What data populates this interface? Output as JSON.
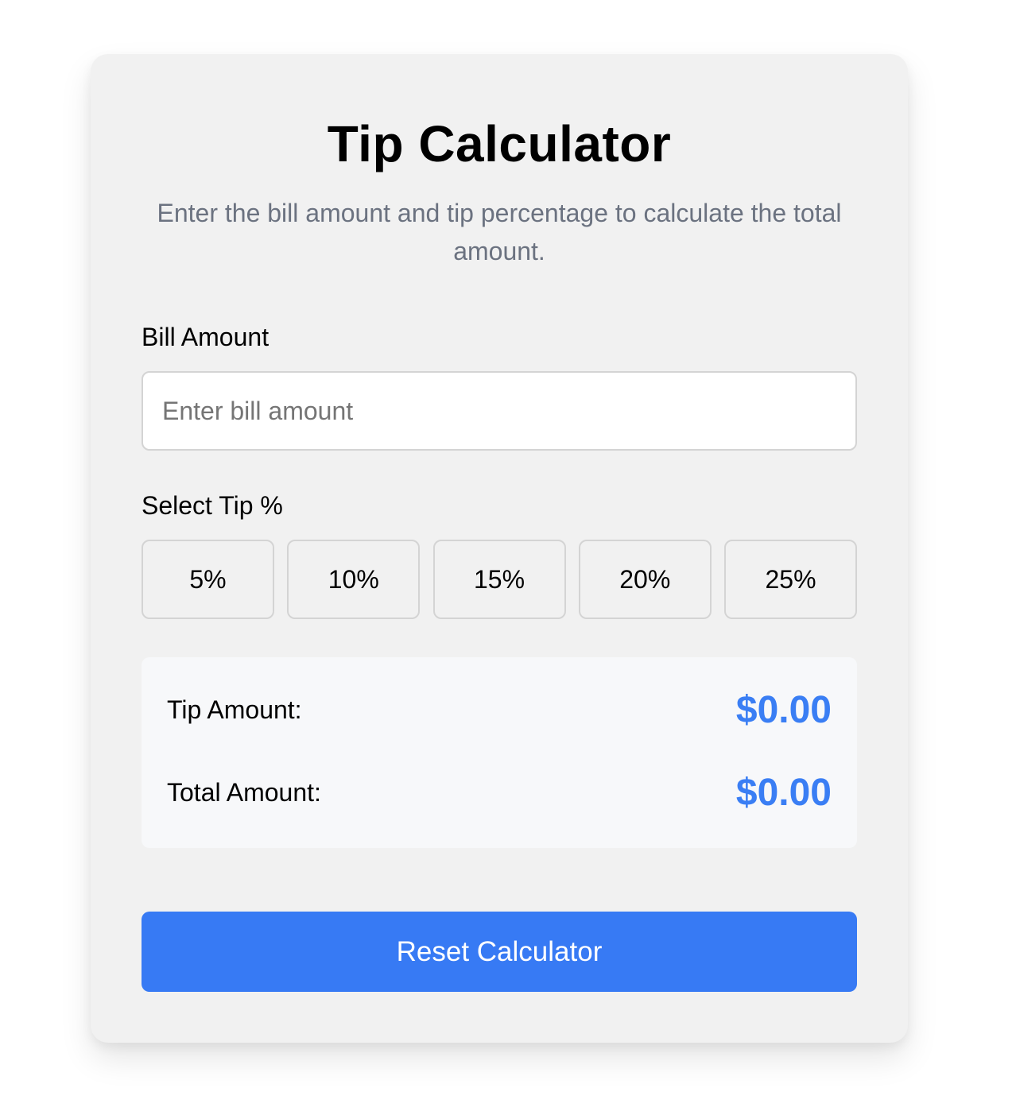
{
  "header": {
    "title": "Tip Calculator",
    "subtitle": "Enter the bill amount and tip percentage to calculate the total amount."
  },
  "bill": {
    "label": "Bill Amount",
    "placeholder": "Enter bill amount",
    "value": ""
  },
  "tip": {
    "label": "Select Tip %",
    "options": [
      "5%",
      "10%",
      "15%",
      "20%",
      "25%"
    ]
  },
  "results": {
    "tip_label": "Tip Amount:",
    "tip_value": "$0.00",
    "total_label": "Total Amount:",
    "total_value": "$0.00"
  },
  "reset": {
    "label": "Reset Calculator"
  },
  "colors": {
    "accent": "#377af4",
    "value_text": "#3a7ef4",
    "card_bg": "#f1f1f1",
    "results_bg": "#f7f8fa",
    "subtitle_text": "#6b7280"
  }
}
